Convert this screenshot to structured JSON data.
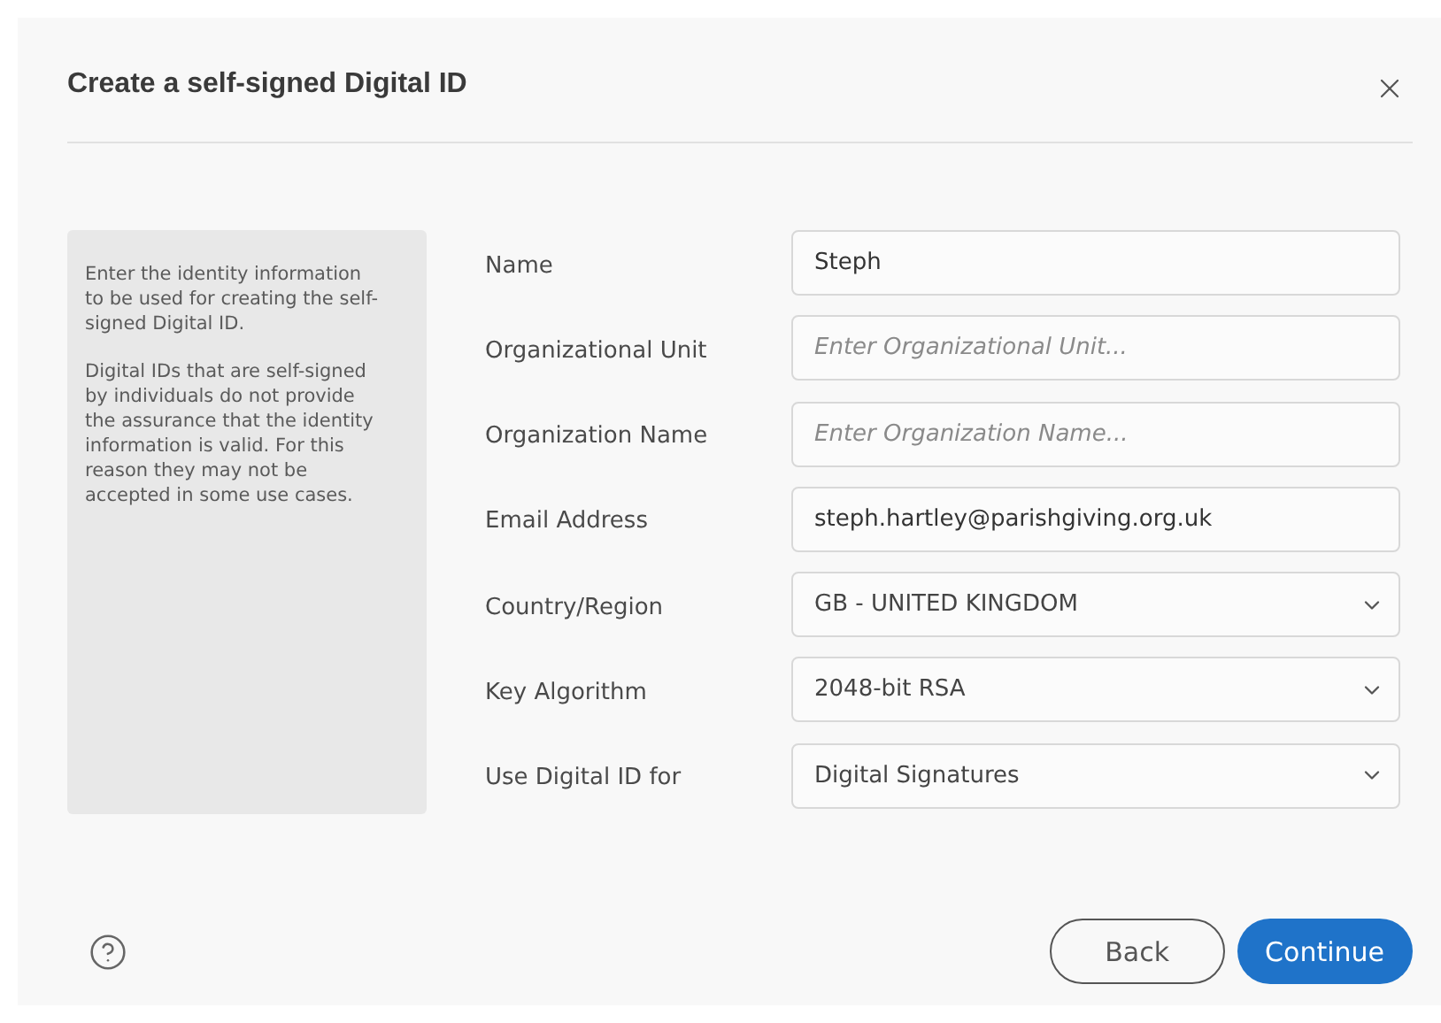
{
  "dialog": {
    "title": "Create a self-signed Digital ID"
  },
  "info": [
    "Enter the identity information to be used for creating the self-signed Digital ID.",
    "Digital IDs that are self-signed by individuals do not provide the assurance that the identity information is valid. For this reason they may not be accepted in some use cases."
  ],
  "fields": [
    {
      "kind": "text",
      "label": "Name",
      "value": "Steph"
    },
    {
      "kind": "text",
      "label": "Organizational Unit",
      "placeholder": "Enter Organizational Unit..."
    },
    {
      "kind": "text",
      "label": "Organization Name",
      "placeholder": "Enter Organization Name..."
    },
    {
      "kind": "text",
      "label": "Email Address",
      "value": "steph.hartley@parishgiving.org.uk"
    },
    {
      "kind": "select",
      "label": "Country/Region",
      "value": "GB - UNITED KINGDOM"
    },
    {
      "kind": "select",
      "label": "Key Algorithm",
      "value": "2048-bit RSA"
    },
    {
      "kind": "select",
      "label": "Use Digital ID for",
      "value": "Digital Signatures"
    }
  ],
  "buttons": [
    {
      "kind": "secondary",
      "label": "Back"
    },
    {
      "kind": "primary",
      "label": "Continue"
    }
  ]
}
